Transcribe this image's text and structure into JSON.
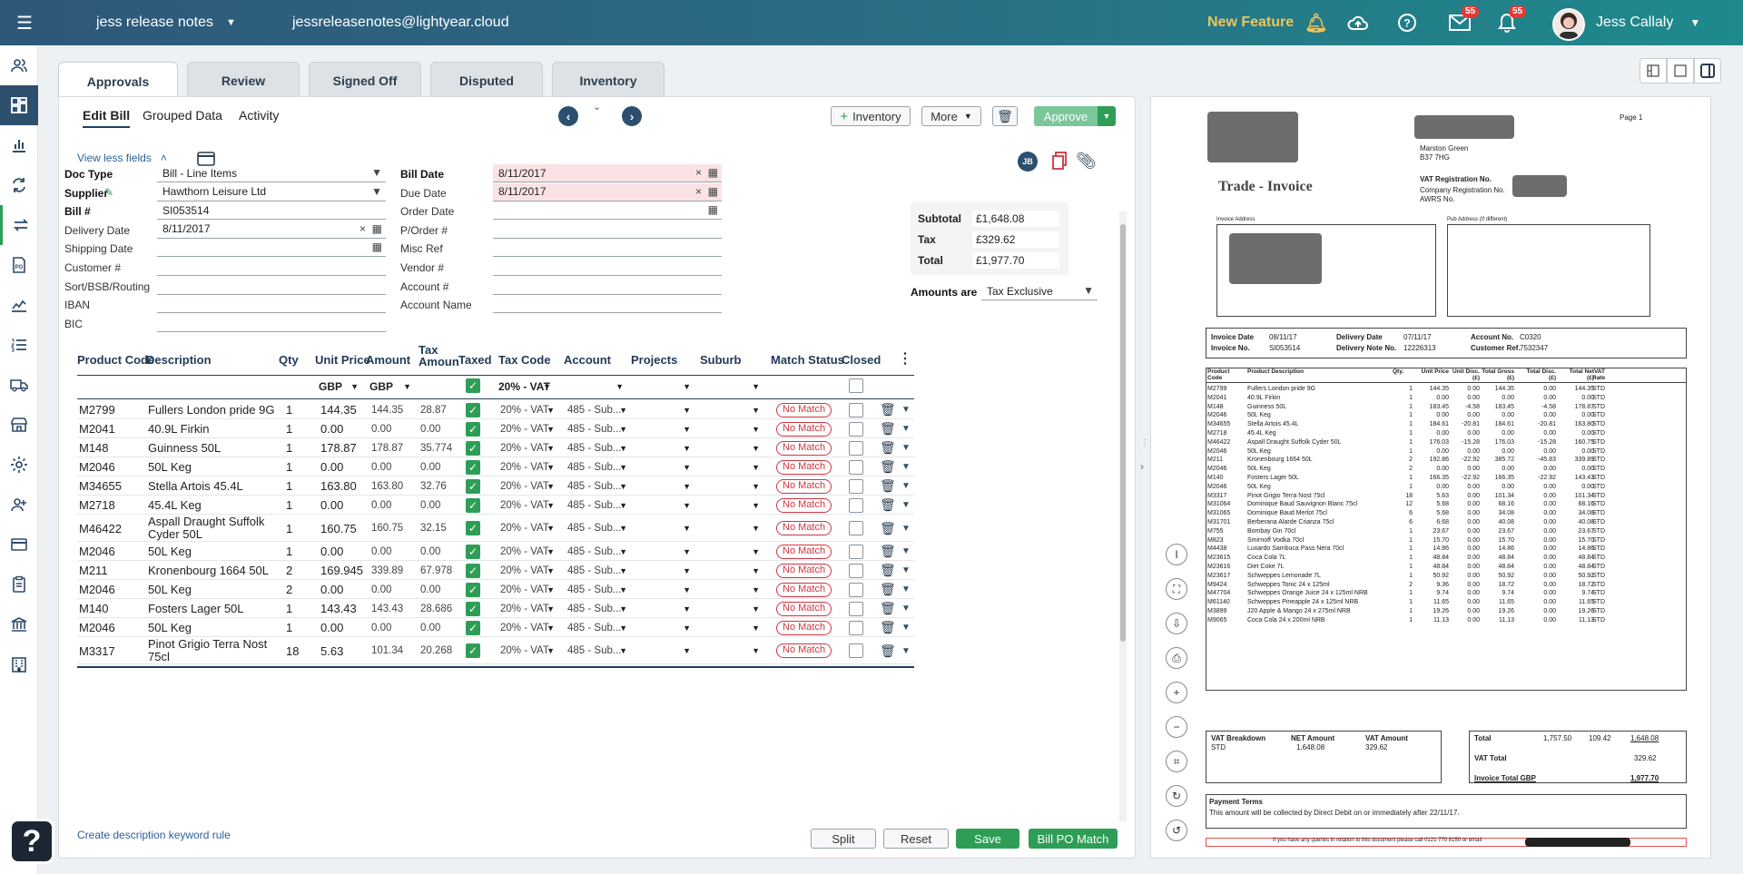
{
  "topbar": {
    "org": "jess release notes",
    "email": "jessreleasenotes@lightyear.cloud",
    "new_feature": "New Feature",
    "mail_badge": "55",
    "notif_badge": "55",
    "user": "Jess Callaly"
  },
  "tabs": [
    "Approvals",
    "Review",
    "Signed Off",
    "Disputed",
    "Inventory"
  ],
  "subtabs": [
    "Edit Bill",
    "Grouped Data",
    "Activity"
  ],
  "actions": {
    "inventory": "Inventory",
    "more": "More",
    "approve": "Approve",
    "initials": "JB"
  },
  "view_less": "View less fields",
  "form_left": [
    {
      "label": "Doc Type",
      "value": "Bill - Line Items",
      "bold": true
    },
    {
      "label": "Supplier",
      "value": "Hawthorn Leisure Ltd",
      "bold": true
    },
    {
      "label": "Bill #",
      "value": "SI053514",
      "bold": true
    },
    {
      "label": "Delivery Date",
      "value": "8/11/2017"
    },
    {
      "label": "Shipping Date",
      "value": ""
    },
    {
      "label": "Customer #",
      "value": ""
    },
    {
      "label": "Sort/BSB/Routing",
      "value": ""
    },
    {
      "label": "IBAN",
      "value": ""
    },
    {
      "label": "BIC",
      "value": ""
    }
  ],
  "form_mid": [
    {
      "label": "Bill Date",
      "value": "8/11/2017",
      "bold": true
    },
    {
      "label": "Due Date",
      "value": "8/11/2017"
    },
    {
      "label": "Order Date",
      "value": ""
    },
    {
      "label": "P/Order #",
      "value": ""
    },
    {
      "label": "Misc Ref",
      "value": ""
    },
    {
      "label": "Vendor #",
      "value": ""
    },
    {
      "label": "Account #",
      "value": ""
    },
    {
      "label": "Account Name",
      "value": ""
    }
  ],
  "totals": {
    "subtotal_label": "Subtotal",
    "subtotal": "£1,648.08",
    "tax_label": "Tax",
    "tax": "£329.62",
    "total_label": "Total",
    "total": "£1,977.70",
    "amounts_label": "Amounts are",
    "amounts_value": "Tax Exclusive"
  },
  "table": {
    "headers": [
      "Product Code",
      "Description",
      "Qty",
      "Unit Price",
      "Amount",
      "Tax Amoun",
      "Taxed",
      "Tax Code",
      "Account",
      "Projects",
      "Suburb",
      "Match Status",
      "Closed"
    ],
    "filter": {
      "currency1": "GBP",
      "currency2": "GBP",
      "taxcode": "20% - VAT"
    },
    "rows": [
      {
        "code": "M2799",
        "desc": "Fullers London pride 9G",
        "qty": "1",
        "unit": "144.35",
        "amount": "144.35",
        "tax": "28.87"
      },
      {
        "code": "M2041",
        "desc": "40.9L Firkin",
        "qty": "1",
        "unit": "0.00",
        "amount": "0.00",
        "tax": "0.00"
      },
      {
        "code": "M148",
        "desc": "Guinness  50L",
        "qty": "1",
        "unit": "178.87",
        "amount": "178.87",
        "tax": "35.774"
      },
      {
        "code": "M2046",
        "desc": "50L Keg",
        "qty": "1",
        "unit": "0.00",
        "amount": "0.00",
        "tax": "0.00"
      },
      {
        "code": "M34655",
        "desc": "Stella Artois  45.4L",
        "qty": "1",
        "unit": "163.80",
        "amount": "163.80",
        "tax": "32.76"
      },
      {
        "code": "M2718",
        "desc": "45.4L Keg",
        "qty": "1",
        "unit": "0.00",
        "amount": "0.00",
        "tax": "0.00"
      },
      {
        "code": "M46422",
        "desc": "Aspall Draught Suffolk Cyder 50L",
        "qty": "1",
        "unit": "160.75",
        "amount": "160.75",
        "tax": "32.15"
      },
      {
        "code": "M2046",
        "desc": "50L Keg",
        "qty": "1",
        "unit": "0.00",
        "amount": "0.00",
        "tax": "0.00"
      },
      {
        "code": "M211",
        "desc": "Kronenbourg 1664  50L",
        "qty": "2",
        "unit": "169.945",
        "amount": "339.89",
        "tax": "67.978"
      },
      {
        "code": "M2046",
        "desc": "50L Keg",
        "qty": "2",
        "unit": "0.00",
        "amount": "0.00",
        "tax": "0.00"
      },
      {
        "code": "M140",
        "desc": "Fosters Lager  50L",
        "qty": "1",
        "unit": "143.43",
        "amount": "143.43",
        "tax": "28.686"
      },
      {
        "code": "M2046",
        "desc": "50L Keg",
        "qty": "1",
        "unit": "0.00",
        "amount": "0.00",
        "tax": "0.00"
      },
      {
        "code": "M3317",
        "desc": "Pinot Grigio Terra Nost 75cl",
        "qty": "18",
        "unit": "5.63",
        "amount": "101.34",
        "tax": "20.268"
      }
    ],
    "row_taxcode": "20% - VAT",
    "row_account": "485 - Sub...",
    "row_match": "No Match"
  },
  "footer": {
    "create_rule": "Create description keyword rule",
    "split": "Split",
    "reset": "Reset",
    "save": "Save",
    "bill_po": "Bill PO Match"
  },
  "invoice": {
    "page": "Page  1",
    "addr1": "Marston Green",
    "addr2": "B37 7HG",
    "title": "Trade - Invoice",
    "vat_reg": "VAT Registration No.",
    "comp_reg": "Company Registration No.",
    "awrs": "AWRS No.",
    "inv_addr": "Invoice Address",
    "pub_addr": "Pub Address (If different)",
    "meta": [
      [
        "Invoice Date",
        "08/11/17",
        "Delivery Date",
        "07/11/17",
        "Account No.",
        "C0320"
      ],
      [
        "Invoice No.",
        "SI053514",
        "Delivery Note No.",
        "12226313",
        "Customer Ref.",
        "7532347"
      ]
    ],
    "cols": [
      "Product Code",
      "Product Description",
      "Qty.",
      "Unit Price",
      "Unit Disc. (£)",
      "Total Gross (£)",
      "Total Disc. (£)",
      "Total Net (£)",
      "VAT Rate"
    ],
    "lines": [
      [
        "M2799",
        "Fullers London pride 9G",
        "1",
        "144.35",
        "0.00",
        "144.35",
        "0.00",
        "144.35",
        "STD"
      ],
      [
        "M2041",
        "40.9L Firkin",
        "1",
        "0.00",
        "0.00",
        "0.00",
        "0.00",
        "0.00",
        "STD"
      ],
      [
        "M148",
        "Guinness  50L",
        "1",
        "183.45",
        "-4.58",
        "183.45",
        "-4.58",
        "178.87",
        "STD"
      ],
      [
        "M2046",
        "50L Keg",
        "1",
        "0.00",
        "0.00",
        "0.00",
        "0.00",
        "0.00",
        "STD"
      ],
      [
        "M34655",
        "Stella Artois  45.4L",
        "1",
        "184.61",
        "-20.81",
        "184.61",
        "-20.81",
        "163.80",
        "STD"
      ],
      [
        "M2718",
        "45.4L Keg",
        "1",
        "0.00",
        "0.00",
        "0.00",
        "0.00",
        "0.00",
        "STD"
      ],
      [
        "M46422",
        "Aspall Draught Suffolk Cyder 50L",
        "1",
        "176.03",
        "-15.28",
        "176.03",
        "-15.28",
        "160.75",
        "STD"
      ],
      [
        "M2046",
        "50L Keg",
        "1",
        "0.00",
        "0.00",
        "0.00",
        "0.00",
        "0.00",
        "STD"
      ],
      [
        "M211",
        "Kronenbourg 1664  50L",
        "2",
        "192.86",
        "-22.92",
        "385.72",
        "-45.83",
        "339.89",
        "STD"
      ],
      [
        "M2046",
        "50L Keg",
        "2",
        "0.00",
        "0.00",
        "0.00",
        "0.00",
        "0.00",
        "STD"
      ],
      [
        "M140",
        "Fosters Lager  50L",
        "1",
        "166.35",
        "-22.92",
        "166.35",
        "-22.92",
        "143.43",
        "STD"
      ],
      [
        "M2046",
        "50L Keg",
        "1",
        "0.00",
        "0.00",
        "0.00",
        "0.00",
        "0.00",
        "STD"
      ],
      [
        "M3317",
        "Pinot Grigio Terra Nost  75cl",
        "18",
        "5.63",
        "0.00",
        "101.34",
        "0.00",
        "101.34",
        "STD"
      ],
      [
        "M31064",
        "Dominique Baud Sauvignon Blanc  75cl",
        "12",
        "5.68",
        "0.00",
        "68.16",
        "0.00",
        "68.16",
        "STD"
      ],
      [
        "M31065",
        "Dominique Baud Merlot  75cl",
        "6",
        "5.68",
        "0.00",
        "34.08",
        "0.00",
        "34.08",
        "STD"
      ],
      [
        "M31701",
        "Berberana Alarde Crianza  75cl",
        "6",
        "6.68",
        "0.00",
        "40.08",
        "0.00",
        "40.08",
        "STD"
      ],
      [
        "M755",
        "Bombay Gin  70cl",
        "1",
        "23.67",
        "0.00",
        "23.67",
        "0.00",
        "23.67",
        "STD"
      ],
      [
        "M823",
        "Smirnoff Vodka  70cl",
        "1",
        "15.70",
        "0.00",
        "15.70",
        "0.00",
        "15.70",
        "STD"
      ],
      [
        "M4438",
        "Luxardo Sambuca Pass Nera  70cl",
        "1",
        "14.86",
        "0.00",
        "14.86",
        "0.00",
        "14.86",
        "STD"
      ],
      [
        "M23615",
        "Coca Cola  7L",
        "1",
        "48.84",
        "0.00",
        "48.84",
        "0.00",
        "48.84",
        "STD"
      ],
      [
        "M23616",
        "Diet Coke  7L",
        "1",
        "48.84",
        "0.00",
        "48.84",
        "0.00",
        "48.84",
        "STD"
      ],
      [
        "M23617",
        "Schweppes Lemonade  7L",
        "1",
        "50.92",
        "0.00",
        "50.92",
        "0.00",
        "50.92",
        "STD"
      ],
      [
        "M9424",
        "Schweppes Tonic 24 x 125ml",
        "2",
        "9.36",
        "0.00",
        "18.72",
        "0.00",
        "18.72",
        "STD"
      ],
      [
        "M47704",
        "Schweppes Orange Juice  24 x 125ml NRB",
        "1",
        "9.74",
        "0.00",
        "9.74",
        "0.00",
        "9.74",
        "STD"
      ],
      [
        "M61140",
        "Schweppes Pineapple  24 x 125ml NRB",
        "1",
        "11.65",
        "0.00",
        "11.65",
        "0.00",
        "11.65",
        "STD"
      ],
      [
        "M3899",
        "J20 Apple & Mango  24 x 275ml NRB",
        "1",
        "19.26",
        "0.00",
        "19.26",
        "0.00",
        "19.26",
        "STD"
      ],
      [
        "M9065",
        "Coca Cola  24 x 200ml NRB",
        "1",
        "11.13",
        "0.00",
        "11.13",
        "0.00",
        "11.13",
        "STD"
      ]
    ],
    "vat_breakdown": "VAT Breakdown",
    "net_amount": "NET Amount",
    "vat_amount": "VAT Amount",
    "std": "STD",
    "std_net": "1,648.08",
    "std_vat": "329.62",
    "total_label": "Total",
    "total_gross": "1,757.50",
    "total_disc": "109.42",
    "total_net": "1,648.08",
    "vat_total_label": "VAT Total",
    "vat_total": "329.62",
    "inv_total_label": "Invoice Total GBP",
    "inv_total": "1,977.70",
    "pay_terms": "Payment Terms",
    "pay_text": "This amount will be collected by Direct Debit  on or immediately after 22/11/17.",
    "query": "If you have any queries in relation to this document please call 0121 770 8150 or email"
  }
}
